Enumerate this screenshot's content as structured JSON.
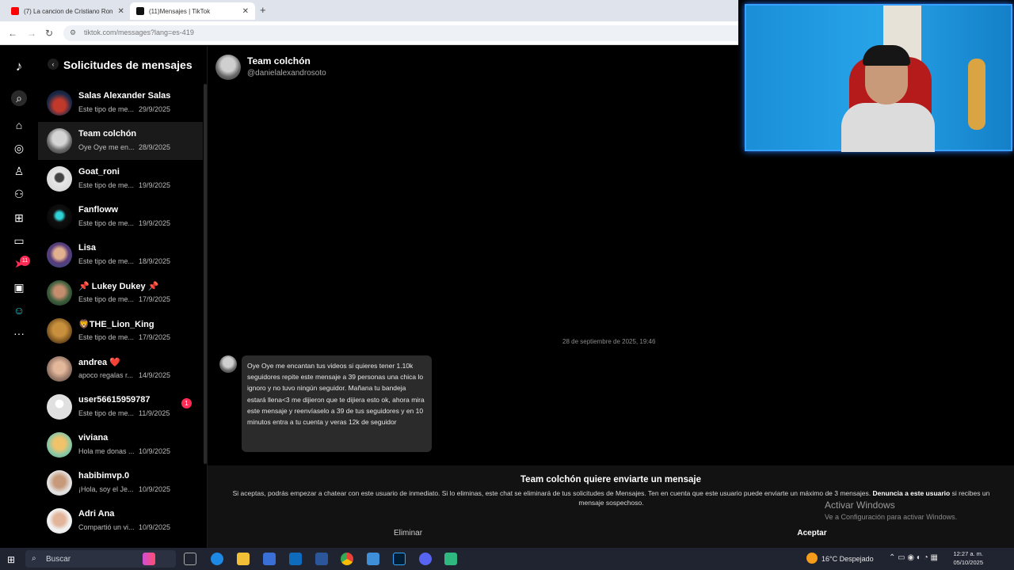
{
  "browser": {
    "tabs": [
      {
        "label": "(7) La cancion de Cristiano Ron",
        "favicon": "youtube-icon",
        "color": "#ff0000"
      },
      {
        "label": "(11)Mensajes | TikTok",
        "favicon": "tiktok-icon",
        "color": "#000000"
      }
    ],
    "new_tab": "+",
    "url": "tiktok.com/messages?lang=es-419"
  },
  "rail": {
    "icons": [
      "tiktok-logo-icon",
      "search-icon",
      "home-icon",
      "explore-icon",
      "following-icon",
      "friends-icon",
      "upload-icon",
      "messages-icon",
      "inbox-icon",
      "live-icon",
      "profile-icon",
      "more-icon"
    ],
    "inbox_badge": "11"
  },
  "list": {
    "title": "Solicitudes de mensajes",
    "rows": [
      {
        "name": "Salas Alexander Salas",
        "preview": "Este tipo de me...",
        "date": "29/9/2025",
        "unread": ""
      },
      {
        "name": "Team colchón",
        "preview": "Oye Oye me en...",
        "date": "28/9/2025",
        "unread": ""
      },
      {
        "name": "Goat_roni",
        "preview": "Este tipo de me...",
        "date": "19/9/2025",
        "unread": ""
      },
      {
        "name": "Fanfloww",
        "preview": "Este tipo de me...",
        "date": "19/9/2025",
        "unread": ""
      },
      {
        "name": "Lisa",
        "preview": "Este tipo de me...",
        "date": "18/9/2025",
        "unread": ""
      },
      {
        "name": "📌 Lukey Dukey 📌",
        "preview": "Este tipo de me...",
        "date": "17/9/2025",
        "unread": ""
      },
      {
        "name": "🦁THE_Lion_King",
        "preview": "Este tipo de me...",
        "date": "17/9/2025",
        "unread": ""
      },
      {
        "name": "andrea ❤️",
        "preview": "apoco regalas r...",
        "date": "14/9/2025",
        "unread": ""
      },
      {
        "name": "user56615959787",
        "preview": "Este tipo de me...",
        "date": "11/9/2025",
        "unread": "1"
      },
      {
        "name": "viviana",
        "preview": "Hola me donas ...",
        "date": "10/9/2025",
        "unread": ""
      },
      {
        "name": "habibimvp.0",
        "preview": "¡Hola, soy el Je...",
        "date": "10/9/2025",
        "unread": ""
      },
      {
        "name": "Adri Ana",
        "preview": "Compartió un vi...",
        "date": "10/9/2025",
        "unread": ""
      }
    ]
  },
  "chat": {
    "name": "Team colchón",
    "handle": "@danielalexandrosoto",
    "date_separator": "28 de septiembre de 2025, 19:46",
    "message": "Oye Oye me encantan tus videos si quieres tener 1.10k seguidores repite este mensaje a 39 personas una chica lo ignoro y no tuvo ningún seguidor. Mañana tu bandeja estará llena<3 me dijieron que te dijiera esto ok, ahora mira este mensaje y reenvíaselo a 39 de tus seguidores y en 10 minutos entra a tu cuenta y veras 12k de seguidor"
  },
  "request": {
    "title": "Team colchón quiere enviarte un mensaje",
    "text_before": "Si aceptas, podrás empezar a chatear con este usuario de inmediato. Si lo eliminas, este chat se eliminará de tus solicitudes de Mensajes. Ten en cuenta que este usuario puede enviarte un máximo de 3 mensajes. ",
    "report_link": "Denuncia a este usuario",
    "text_after": " si recibes un mensaje sospechoso.",
    "delete_label": "Eliminar",
    "accept_label": "Aceptar"
  },
  "watermark": {
    "line1": "Activar Windows",
    "line2": "Ve a Configuración para activar Windows."
  },
  "taskbar": {
    "search_placeholder": "Buscar",
    "weather": "16°C  Despejado",
    "time": "12:27 a. m.",
    "date": "05/10/2025",
    "apps": [
      "edge-icon",
      "file-explorer-icon",
      "store-icon",
      "outlook-icon",
      "word-icon",
      "chrome-icon",
      "mail-icon",
      "photoshop-icon",
      "discord-icon",
      "app-icon"
    ]
  }
}
